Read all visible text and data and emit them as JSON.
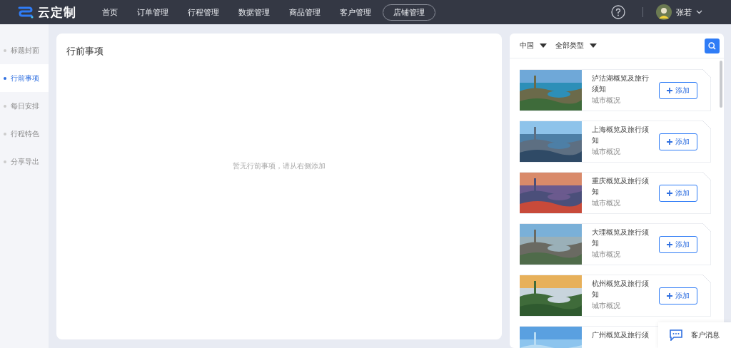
{
  "header": {
    "logo": "云定制",
    "nav": [
      {
        "label": "首页",
        "selected": false,
        "outlined": false
      },
      {
        "label": "订单管理",
        "selected": false,
        "outlined": false
      },
      {
        "label": "行程管理",
        "selected": false,
        "outlined": false
      },
      {
        "label": "数据管理",
        "selected": false,
        "outlined": false
      },
      {
        "label": "商品管理",
        "selected": false,
        "outlined": false
      },
      {
        "label": "客户管理",
        "selected": false,
        "outlined": false
      },
      {
        "label": "店铺管理",
        "selected": false,
        "outlined": true
      }
    ],
    "user": "张若"
  },
  "sidebar": {
    "items": [
      {
        "label": "标题封面",
        "selected": false
      },
      {
        "label": "行前事项",
        "selected": true
      },
      {
        "label": "每日安排",
        "selected": false
      },
      {
        "label": "行程特色",
        "selected": false
      },
      {
        "label": "分享导出",
        "selected": false
      }
    ]
  },
  "main": {
    "title": "行前事项",
    "empty_text": "暂无行前事项，请从右侧添加"
  },
  "library": {
    "filters": [
      "中国",
      "全部类型"
    ],
    "items": [
      {
        "title": "泸沽湖概览及旅行须知",
        "category": "城市概况",
        "button": "添加"
      },
      {
        "title": "上海概览及旅行须知",
        "category": "城市概况",
        "button": "添加"
      },
      {
        "title": "重庆概览及旅行须知",
        "category": "城市概况",
        "button": "添加"
      },
      {
        "title": "大理概览及旅行须知",
        "category": "城市概况",
        "button": "添加"
      },
      {
        "title": "杭州概览及旅行须知",
        "category": "城市概况",
        "button": "添加"
      },
      {
        "title": "广州概览及旅行须"
      }
    ]
  },
  "chat": {
    "label": "客户消息"
  }
}
